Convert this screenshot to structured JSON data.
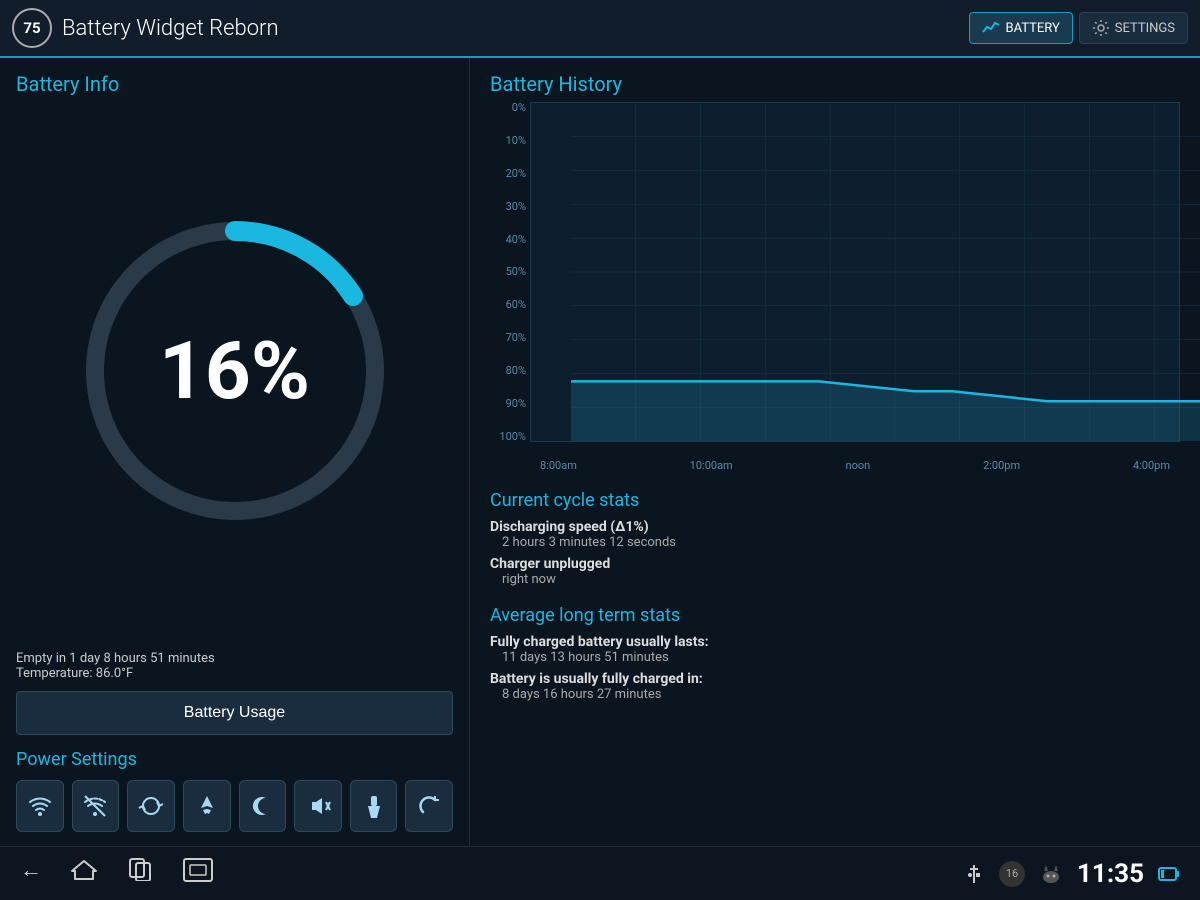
{
  "topbar": {
    "badge_number": "75",
    "app_title": "Battery Widget Reborn",
    "battery_btn": "BATTERY",
    "settings_btn": "SETTINGS"
  },
  "left": {
    "battery_info_title": "Battery Info",
    "battery_percent": "16%",
    "empty_time": "Empty in 1 day 8 hours 51 minutes",
    "temperature": "Temperature: 86.0°F",
    "battery_usage_btn": "Battery Usage",
    "power_settings_title": "Power Settings"
  },
  "right": {
    "battery_history_title": "Battery History",
    "chart": {
      "y_labels": [
        "100%",
        "90%",
        "80%",
        "70%",
        "60%",
        "50%",
        "40%",
        "30%",
        "20%",
        "10%",
        "0%"
      ],
      "x_labels": [
        "8:00am",
        "10:00am",
        "noon",
        "2:00pm",
        "4:00pm"
      ]
    },
    "current_cycle_title": "Current cycle stats",
    "stats": [
      {
        "label": "Discharging speed (Δ1%)",
        "value": "2 hours 3 minutes 12 seconds"
      },
      {
        "label": "Charger unplugged",
        "value": "right now"
      }
    ],
    "avg_title": "Average long term stats",
    "avg_stats": [
      {
        "label": "Fully charged battery usually lasts:",
        "value": "11 days 13 hours 51 minutes"
      },
      {
        "label": "Battery is usually fully charged in:",
        "value": "8 days 16 hours 27 minutes"
      }
    ]
  },
  "bottombar": {
    "clock": "11:35",
    "battery_level": "16"
  },
  "power_icons": [
    "wifi_on",
    "wifi_off",
    "sync",
    "airplane",
    "moon",
    "mute",
    "flashlight",
    "rotate"
  ],
  "colors": {
    "accent": "#1ab8e0",
    "bg": "#0a1520",
    "donut_fill": "#1ab8e0",
    "donut_bg": "#2a3a48"
  }
}
